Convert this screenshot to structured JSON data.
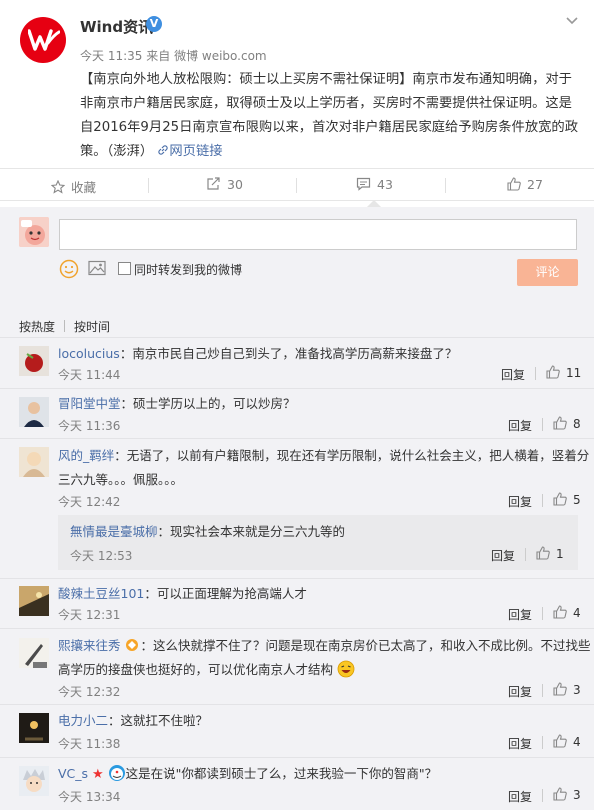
{
  "post": {
    "author": "Wind资讯",
    "verified_badge": "V",
    "time": "今天 11:35",
    "source_prefix": "来自",
    "source": "微博 weibo.com",
    "body_title": "【南京向外地人放松限购：硕士以上买房不需社保证明】",
    "body_text": "南京市发布通知明确，对于非南京市户籍居民家庭，取得硕士及以上学历者，买房时不需要提供社保证明。这是自2016年9月25日南京宣布限购以来，首次对非户籍居民家庭给予购房条件放宽的政策。（澎湃）",
    "link_label": "网页链接"
  },
  "actions": {
    "favorite": "收藏",
    "repost": "30",
    "comment": "43",
    "like": "27"
  },
  "composer": {
    "placeholder": "",
    "forward_label": "同时转发到我的微博",
    "submit_label": "评论"
  },
  "sort": {
    "by_hot": "按热度",
    "by_time": "按时间"
  },
  "comments": [
    {
      "name": "locolucius",
      "text": "：南京市民自己炒自己到头了，准备找高学历高薪来接盘了？",
      "time": "今天 11:44",
      "reply": "回复",
      "likes": "11"
    },
    {
      "name": "冒阳堂中堂",
      "text": "：硕士学历以上的，可以炒房？",
      "time": "今天 11:36",
      "reply": "回复",
      "likes": "8"
    },
    {
      "name": "风的_羁绊",
      "text_line1": "：无语了，以前有户籍限制，现在还有学历限制，说什么社会主义，把人横着，竖着分",
      "text_line2": "三六九等。。。佩服。。。",
      "time": "今天 12:42",
      "reply": "回复",
      "likes": "5",
      "sub": {
        "name": "無情最是臺城柳",
        "text": "：现实社会本来就是分三六九等的",
        "time": "今天 12:53",
        "reply": "回复",
        "likes": "1"
      }
    },
    {
      "name": "酸辣土豆丝101",
      "text": "：可以正面理解为抢高端人才",
      "time": "今天 12:31",
      "reply": "回复",
      "likes": "4"
    },
    {
      "name": "熙攘来往秀",
      "text_line1": "：这么快就撑不住了？问题是现在南京房价已太高了，和收入不成比例。不过找些",
      "text_line2": "高学历的接盘侠也挺好的，可以优化南京人才结构",
      "time": "今天 12:32",
      "reply": "回复",
      "likes": "3"
    },
    {
      "name": "电力小二",
      "text": "：这就扛不住啦？",
      "time": "今天 11:38",
      "reply": "回复",
      "likes": "4"
    },
    {
      "name": "VC_s",
      "text": "这是在说\"你都读到硕士了么，过来我验一下你的智商\"？",
      "time": "今天 13:34",
      "reply": "回复",
      "likes": "3"
    }
  ],
  "colors": {
    "accent": "#eb7350",
    "link": "#4a6ea8",
    "brand_red": "#e60012",
    "verified_blue": "#3f8fe0"
  }
}
